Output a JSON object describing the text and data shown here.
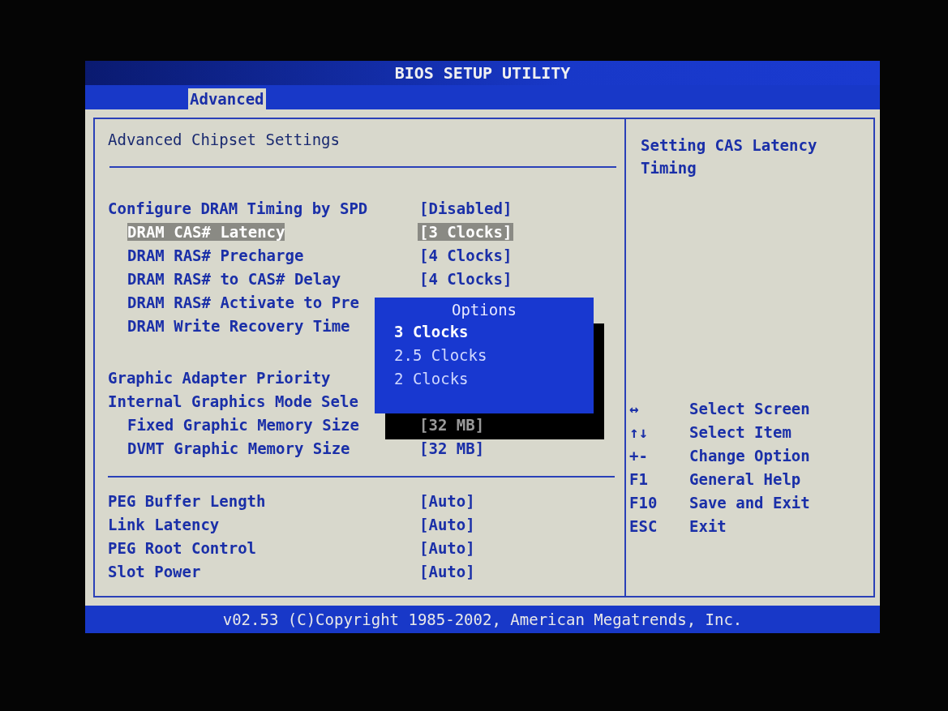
{
  "window": {
    "title": "BIOS SETUP UTILITY"
  },
  "tabs": [
    {
      "label": "Advanced",
      "selected": true
    }
  ],
  "panel": {
    "title": "Advanced Chipset Settings"
  },
  "sections": [
    {
      "groups": [
        {
          "items": [
            {
              "label": "Configure DRAM Timing by SPD",
              "value": "[Disabled]",
              "selected": false,
              "children": [
                {
                  "label": "DRAM CAS# Latency",
                  "value": "[3 Clocks]",
                  "selected": true
                },
                {
                  "label": "DRAM RAS# Precharge",
                  "value": "[4 Clocks]",
                  "selected": false
                },
                {
                  "label": "DRAM RAS# to CAS# Delay",
                  "value": "[4 Clocks]",
                  "selected": false
                },
                {
                  "label": "DRAM RAS# Activate to Pre",
                  "selected": false
                },
                {
                  "label": "DRAM Write Recovery Time",
                  "selected": false
                }
              ]
            }
          ]
        },
        {
          "items": [
            {
              "label": "Graphic Adapter Priority",
              "selected": false
            },
            {
              "label": "Internal Graphics Mode Sele",
              "selected": false,
              "children": [
                {
                  "label": "Fixed Graphic Memory Size",
                  "value": "[32 MB]",
                  "selected": false,
                  "dimmed": true
                },
                {
                  "label": "DVMT Graphic Memory Size",
                  "value": "[32 MB]",
                  "selected": false
                }
              ]
            }
          ]
        }
      ]
    },
    {
      "groups": [
        {
          "items": [
            {
              "label": "PEG Buffer Length",
              "value": "[Auto]",
              "selected": false
            },
            {
              "label": "Link Latency",
              "value": "[Auto]",
              "selected": false
            },
            {
              "label": "PEG Root Control",
              "value": "[Auto]",
              "selected": false
            },
            {
              "label": "Slot Power",
              "value": "[Auto]",
              "selected": false
            }
          ]
        }
      ]
    }
  ],
  "popup": {
    "title": "Options",
    "options": [
      {
        "label": "3 Clocks",
        "selected": true
      },
      {
        "label": "2.5 Clocks",
        "selected": false
      },
      {
        "label": "2 Clocks",
        "selected": false
      }
    ]
  },
  "help": {
    "text": "Setting CAS Latency Timing"
  },
  "keys": [
    {
      "key": "↔",
      "action": "Select Screen"
    },
    {
      "key": "↑↓",
      "action": "Select Item"
    },
    {
      "key": "+-",
      "action": "Change Option"
    },
    {
      "key": "F1",
      "action": "General Help"
    },
    {
      "key": "F10",
      "action": "Save and Exit"
    },
    {
      "key": "ESC",
      "action": "Exit"
    }
  ],
  "footer": "v02.53 (C)Copyright 1985-2002, American Megatrends, Inc."
}
